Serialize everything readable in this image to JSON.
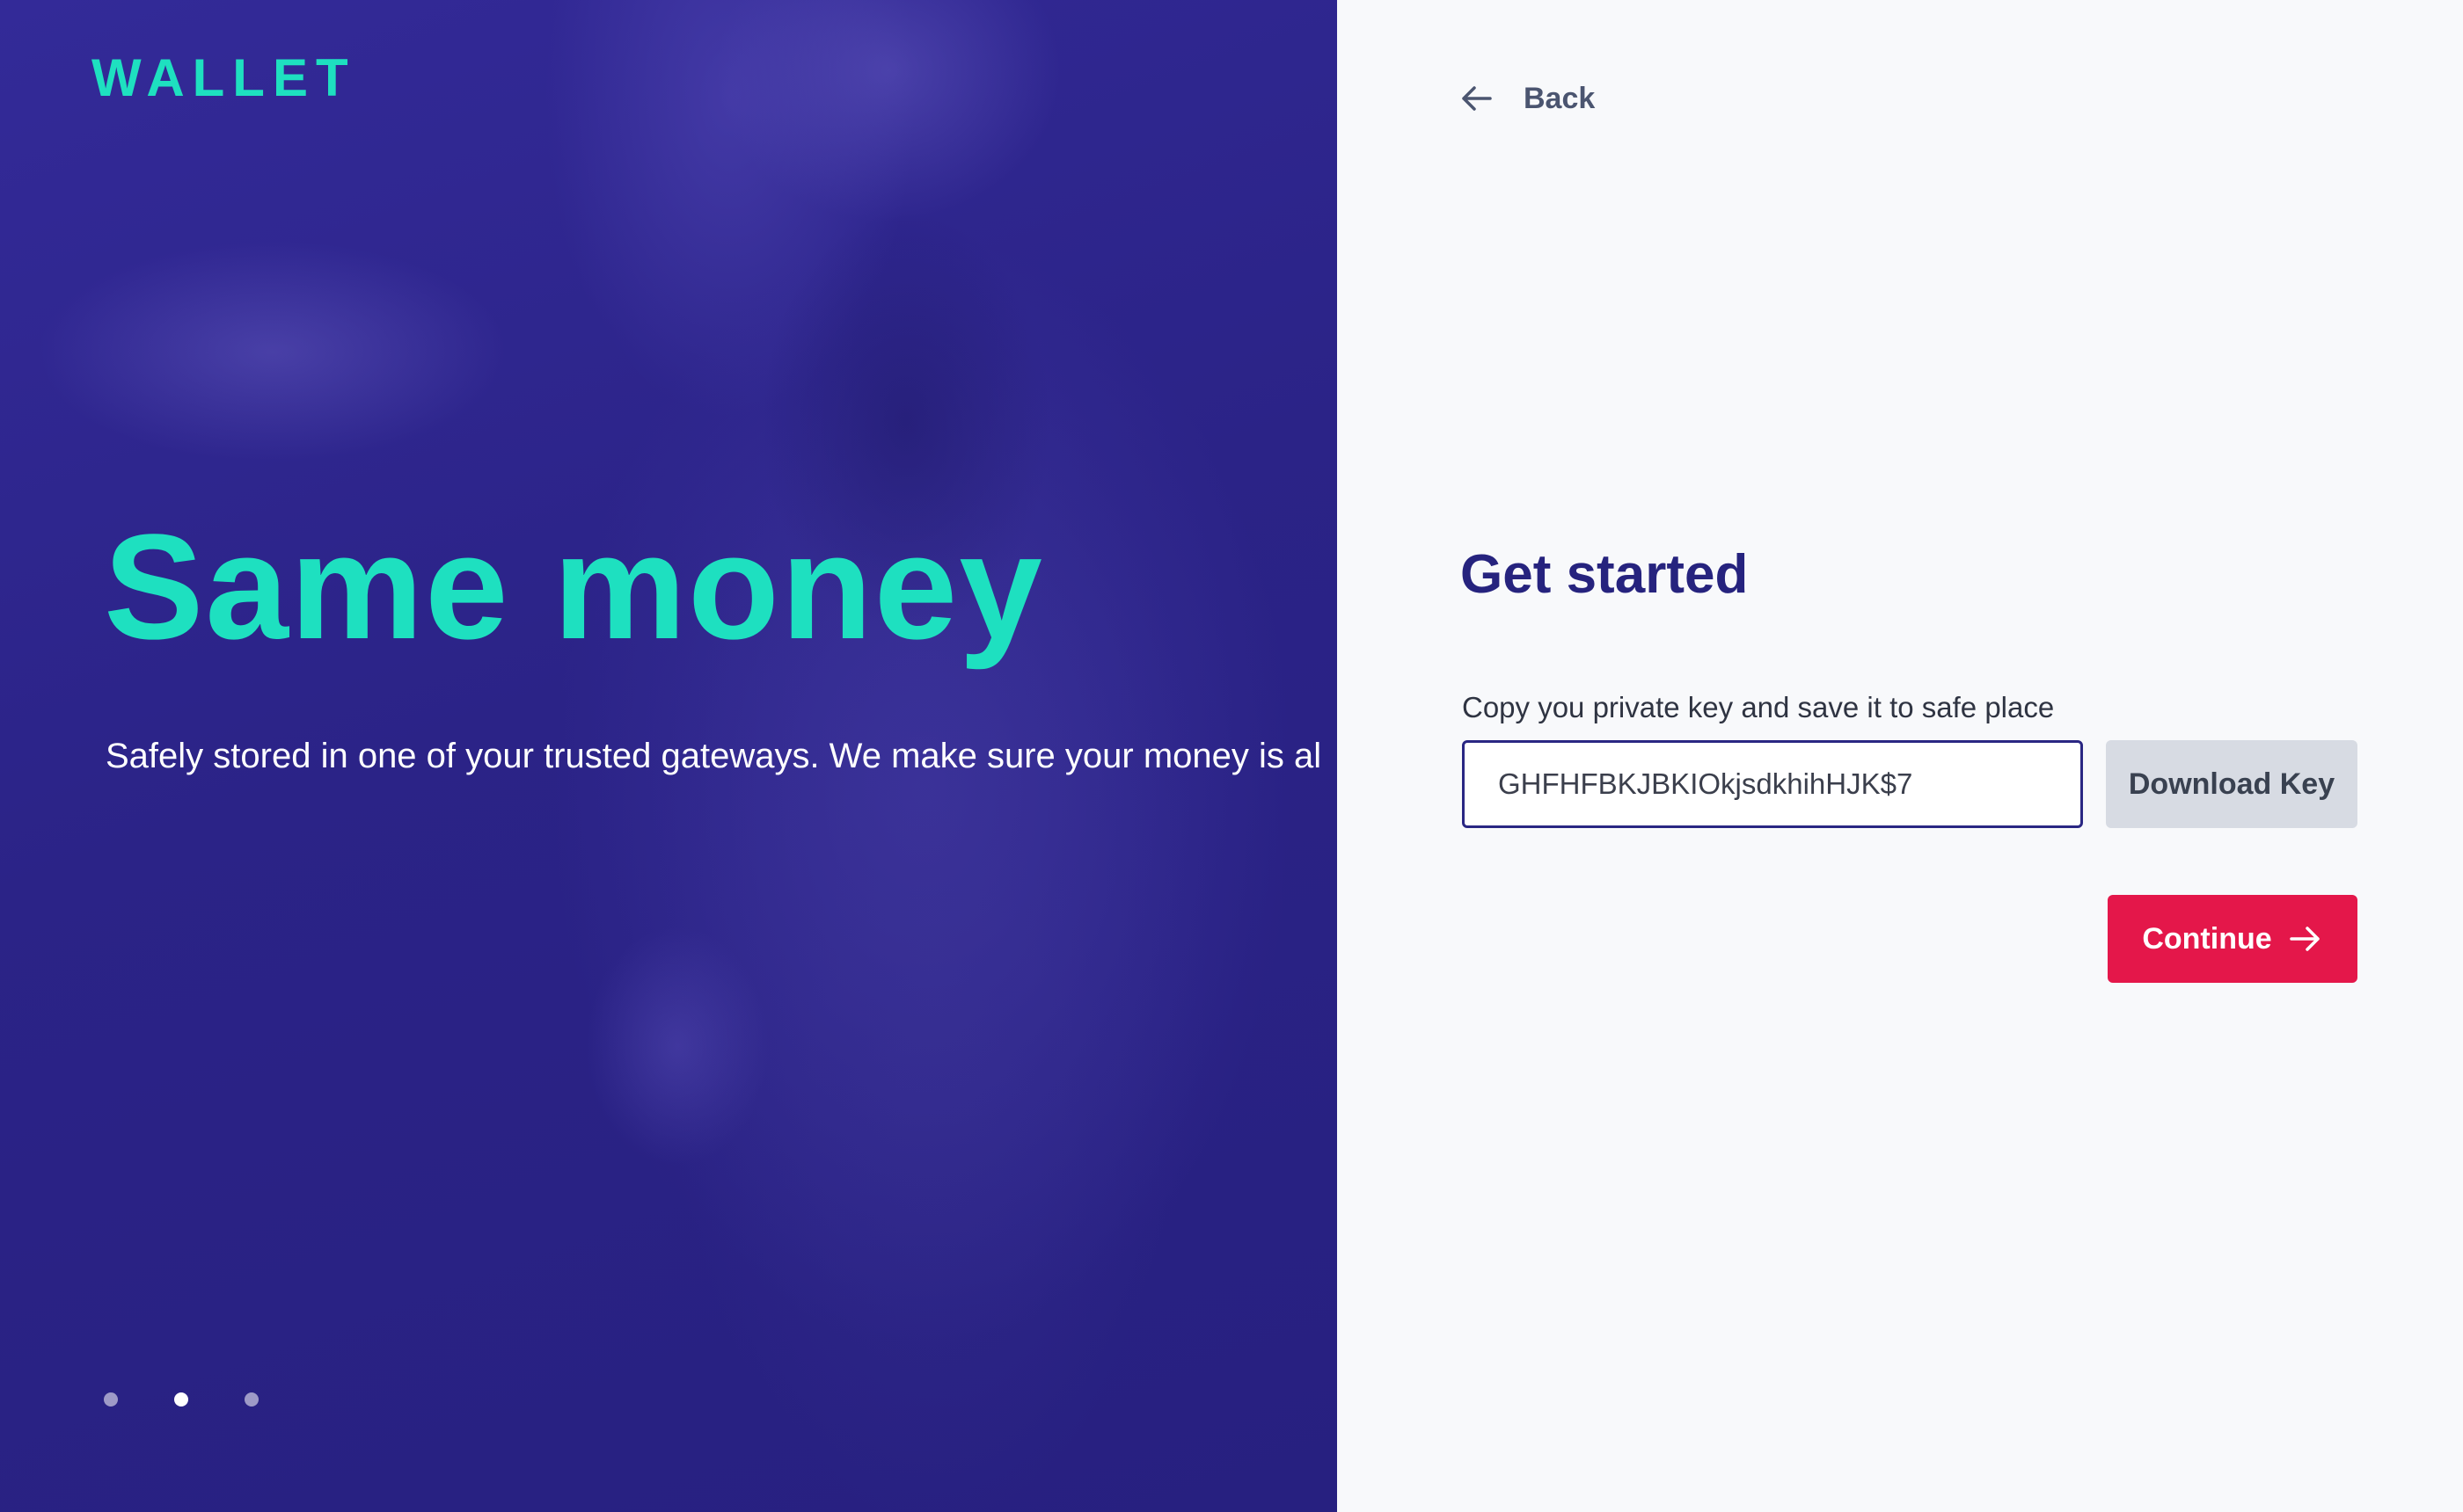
{
  "brand": {
    "logo": "WALLET"
  },
  "hero": {
    "title": "Same money",
    "subtitle": "Safely stored in one of your trusted gateways. We make sure your money is al",
    "slides": 3,
    "active_slide": 1
  },
  "nav": {
    "back_label": "Back",
    "back_icon": "arrow-left-icon"
  },
  "form": {
    "title": "Get started",
    "key_label": "Copy you private key and save it to safe place",
    "key_value": "GHFHFBKJBKIOkjsdkhihHJK$7",
    "download_label": "Download Key",
    "continue_label": "Continue",
    "continue_icon": "arrow-right-icon"
  },
  "colors": {
    "hero_bg": "#2b2387",
    "accent_teal": "#1ee0c0",
    "title_navy": "#26237e",
    "continue_red": "#e4174a",
    "download_gray": "#d7dbe3"
  }
}
